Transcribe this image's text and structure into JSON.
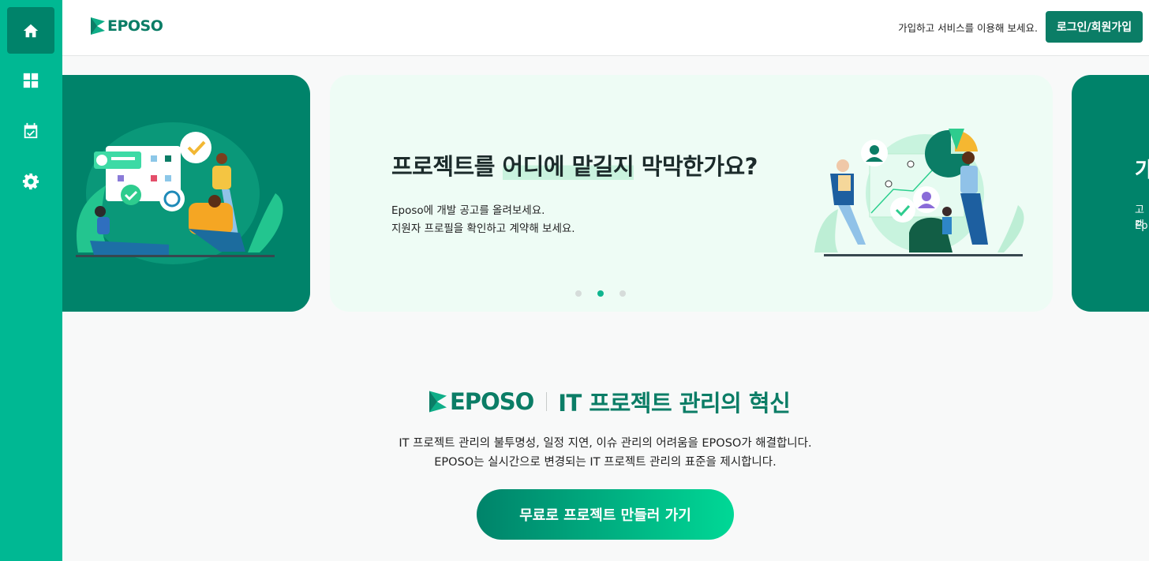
{
  "header": {
    "logo_text": "EPOSO",
    "note": "가입하고 서비스를 이용해 보세요.",
    "login_label": "로그인/회원가입"
  },
  "sidebar": {
    "items": [
      {
        "name": "home",
        "icon": "home-icon",
        "active": true
      },
      {
        "name": "dashboard",
        "icon": "grid-icon",
        "active": false
      },
      {
        "name": "calendar",
        "icon": "calendar-check-icon",
        "active": false
      },
      {
        "name": "settings",
        "icon": "gear-icon",
        "active": false
      }
    ]
  },
  "carousel": {
    "current": {
      "title_pre": "프로젝트를 ",
      "title_hl1": "어디에 맡길지",
      "title_mid": " 막막한가요?",
      "line1": "Eposo에 개발 공고를 올려보세요.",
      "line2": "지원자 프로필을 확인하고 계약해 보세요."
    },
    "next_peek": {
      "title": "가",
      "line1": "고객",
      "line2": "Ep"
    },
    "dots": 3,
    "active_dot": 2
  },
  "intro": {
    "logo_text": "EPOSO",
    "title": "IT 프로젝트 관리의 혁신",
    "line1": "IT 프로젝트 관리의 불투명성, 일정 지연, 이슈 관리의 어려움을 EPOSO가 해결합니다.",
    "line2": "EPOSO는 실시간으로 변경되는 IT 프로젝트 관리의 표준을 제시합니다.",
    "cta_label": "무료로 프로젝트 만들러 가기"
  },
  "colors": {
    "brand_dark": "#0b7d66",
    "brand": "#00b893",
    "card_dark": "#00836a",
    "card_light": "#eefcf5"
  }
}
